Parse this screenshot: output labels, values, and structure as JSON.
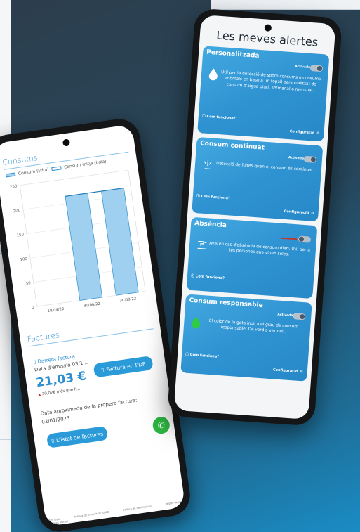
{
  "consums": {
    "title": "Consums",
    "legend_daily": "Consum (l/dia)",
    "legend_avg": "Consum mitjà (l/dia)"
  },
  "chart_data": {
    "type": "bar",
    "categories": [
      "18/04/22",
      "30/06/22",
      "30/09/22"
    ],
    "values": [
      null,
      215,
      215
    ],
    "series_line": [
      null,
      215,
      215
    ],
    "yticks": [
      "0",
      "50",
      "100",
      "150",
      "200",
      "250"
    ],
    "ylim": [
      0,
      250
    ],
    "colors": {
      "bar": "#9fd0ef",
      "bar_stroke": "#2b8fd0"
    }
  },
  "factures": {
    "title": "Factures",
    "last_invoice_label": "Darrera factura",
    "issue_date_label": "Data d'emissió 03/1...",
    "amount": "21,03 €",
    "delta": "30,07€ més que l'...",
    "pdf_button": "Factura en PDF",
    "next_date_label": "Data aproximada de la propera factura:",
    "next_date": "02/01/2023",
    "list_button": "Llistat de factures"
  },
  "footer": {
    "links": [
      "Avís legal",
      "Política de privacitat i RGPD",
      "Política de devolucions",
      "Regles de joc"
    ],
    "cookies": "Cookies Mutual"
  },
  "alerts": {
    "title": "Les meves alertes",
    "help_label": "Com funciona?",
    "config_label": "Configuració",
    "active_label": "Activada",
    "cards": [
      {
        "title": "Personalitzada",
        "description": "Útil per la detecció de sobre consums o consums anòmals en base a un topall personalitzat de consum d'aigua diari, setmanal o mensual.",
        "active": true,
        "icon": "water-drop-icon"
      },
      {
        "title": "Consum continuat",
        "description": "Detecció de fuites quan el consum és continuat.",
        "active": true,
        "icon": "leak-icon"
      },
      {
        "title": "Absència",
        "description": "Avís en cas d'absència de consum diari. Útil per a les persones que viuen soles.",
        "active": false,
        "icon": "tap-icon"
      },
      {
        "title": "Consum responsable",
        "description": "El color de la gota indica el grau de consum responsable. De verd a vermell.",
        "active": true,
        "icon": "green-drop-icon"
      }
    ]
  },
  "colors": {
    "accent": "#2b8fd0",
    "card": "#3198d6",
    "whatsapp": "#2db742",
    "background": "#27475c"
  }
}
